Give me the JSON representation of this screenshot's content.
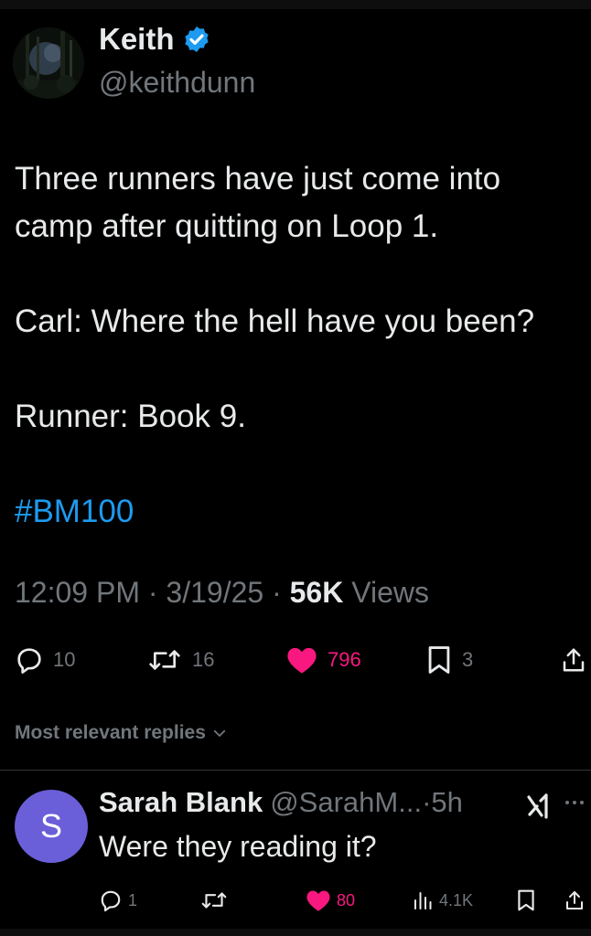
{
  "tweet": {
    "author_name": "Keith",
    "author_handle": "@keithdunn",
    "verified_icon": "verified-badge-icon",
    "paragraphs": [
      "Three runners have just come into camp after quitting on Loop 1.",
      "Carl: Where the hell have you been?",
      "Runner: Book 9."
    ],
    "hashtag": "#BM100",
    "time": "12:09 PM",
    "date": "3/19/25",
    "views_count": "56K",
    "views_label": "Views",
    "separator": "·",
    "stats": {
      "replies": "10",
      "reposts": "16",
      "likes": "796",
      "bookmarks": "3"
    }
  },
  "replies_sort_label": "Most relevant replies",
  "reply": {
    "avatar_letter": "S",
    "name": "Sarah Blank",
    "handle": "@SarahM...",
    "time": "·5h",
    "text": "Were they reading it?",
    "stats": {
      "replies": "1",
      "likes": "80",
      "views": "4.1K"
    }
  },
  "colors": {
    "background": "#000000",
    "text": "#e7e9ea",
    "muted": "#71767b",
    "accent": "#1d9bf0",
    "like": "#f91880",
    "reply_avatar": "#6a5fd8"
  }
}
